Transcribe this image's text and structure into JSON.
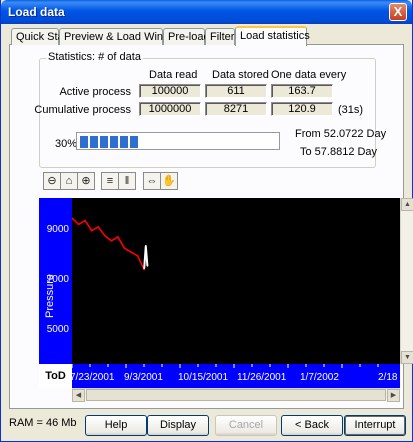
{
  "window": {
    "title": "Load data",
    "close_glyph": "X"
  },
  "tabs": [
    {
      "label": "Quick Stats",
      "active": false
    },
    {
      "label": "Preview & Load Window",
      "active": false
    },
    {
      "label": "Pre-load",
      "active": false
    },
    {
      "label": "Filters",
      "active": false
    },
    {
      "label": "Load statistics",
      "active": true
    }
  ],
  "stats": {
    "group_title": "Statistics: # of data",
    "col_data_read": "Data read",
    "col_data_stored": "Data stored",
    "col_one_every": "One data every",
    "active": {
      "label": "Active process",
      "read": "100000",
      "stored": "611",
      "every": "163.7"
    },
    "cumulative": {
      "label": "Cumulative process",
      "read": "1000000",
      "stored": "8271",
      "every": "120.9",
      "suffix": "(31s)"
    }
  },
  "progress": {
    "label": "30%",
    "fraction": 0.3,
    "from": "From 52.0722 Day",
    "to": "To 57.8812 Day"
  },
  "toolbar": [
    {
      "name": "zoom-out-icon",
      "glyph": "⊖"
    },
    {
      "name": "zoom-fit-icon",
      "glyph": "⌂"
    },
    {
      "name": "zoom-in-icon",
      "glyph": "⊕"
    },
    {
      "name": "axis-scale-icon",
      "glyph": "≡"
    },
    {
      "name": "axis-markers-icon",
      "glyph": "‖"
    },
    {
      "name": "auto-range-icon",
      "glyph": "⇔"
    },
    {
      "name": "pan-hand-icon",
      "glyph": "✋"
    }
  ],
  "chart_data": {
    "type": "line",
    "ylabel": "Pressure",
    "xlabel": "ToD",
    "y_ticks": [
      "9000",
      "7000",
      "5000"
    ],
    "x_ticks": [
      "7/23/2001",
      "9/3/2001",
      "10/15/2001",
      "11/26/2001",
      "1/7/2002",
      "2/18"
    ],
    "series": [
      {
        "color": "#ff0000",
        "x": [
          0.0,
          0.02,
          0.04,
          0.06,
          0.08,
          0.1,
          0.12,
          0.14,
          0.16,
          0.18,
          0.2,
          0.22
        ],
        "y": [
          9400,
          9150,
          9300,
          8900,
          9050,
          8700,
          8500,
          8650,
          8200,
          8050,
          7900,
          7350
        ]
      },
      {
        "color": "#ffffff",
        "x": [
          0.22,
          0.225,
          0.23
        ],
        "y": [
          7400,
          8300,
          7500
        ]
      }
    ]
  },
  "footer": {
    "ram": "RAM = 46 Mb",
    "help": "Help",
    "display": "Display",
    "cancel": "Cancel",
    "back": "< Back",
    "interrupt": "Interrupt"
  }
}
